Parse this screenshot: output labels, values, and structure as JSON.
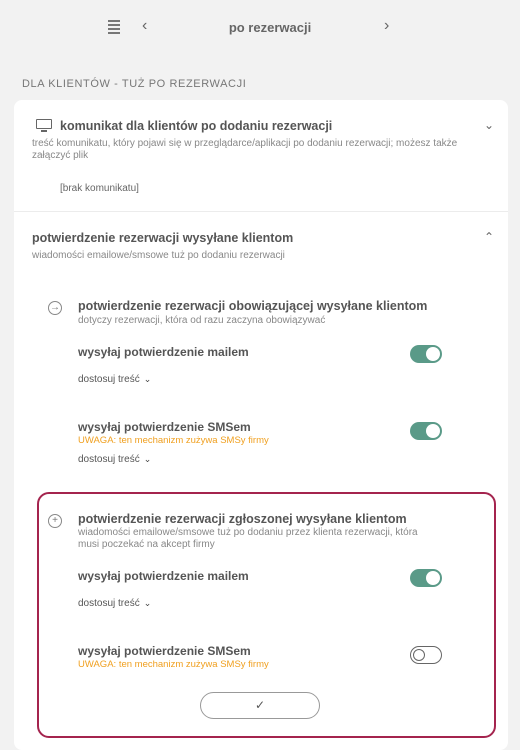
{
  "topbar": {
    "menu_icon": "list-icon",
    "prev_glyph": "‹",
    "title": "po rezerwacji",
    "next_glyph": "›"
  },
  "section_header": "DLA KLIENTÓW - TUŻ PO REZERWACJI",
  "message_block": {
    "icon": "monitor-icon",
    "title": "komunikat dla klientów po dodaniu rezerwacji",
    "description": "treść komunikatu, który pojawi się w przeglądarce/aplikacji po dodaniu rezerwacji; możesz także załączyć plik",
    "value": "[brak komunikatu]",
    "expanded": false
  },
  "confirmation_block": {
    "title": "potwierdzenie rezerwacji wysyłane klientom",
    "description": "wiadomości emailowe/smsowe tuż po dodaniu rezerwacji",
    "expanded": true,
    "binding": {
      "icon": "arrow-right-circle-icon",
      "title": "potwierdzenie rezerwacji obowiązującej wysyłane klientom",
      "description": "dotyczy rezerwacji, która od razu zaczyna obowiązywać",
      "email": {
        "label": "wysyłaj potwierdzenie mailem",
        "enabled": true,
        "customize": "dostosuj treść"
      },
      "sms": {
        "label": "wysyłaj potwierdzenie SMSem",
        "warning": "UWAGA: ten mechanizm zużywa SMSy firmy",
        "enabled": true,
        "customize": "dostosuj treść"
      }
    },
    "pending": {
      "icon": "plus-circle-icon",
      "title": "potwierdzenie rezerwacji zgłoszonej wysyłane klientom",
      "description": "wiadomości emailowe/smsowe tuż po dodaniu przez klienta rezerwacji, która musi poczekać na akcept firmy",
      "email": {
        "label": "wysyłaj potwierdzenie mailem",
        "enabled": true,
        "customize": "dostosuj treść"
      },
      "sms": {
        "label": "wysyłaj potwierdzenie SMSem",
        "warning": "UWAGA: ten mechanizm zużywa SMSy firmy",
        "enabled": false
      }
    },
    "confirm_button_glyph": "✓"
  },
  "colors": {
    "toggle_on": "#5a9a88",
    "warning": "#f0a020",
    "highlight_border": "#a4244e"
  }
}
